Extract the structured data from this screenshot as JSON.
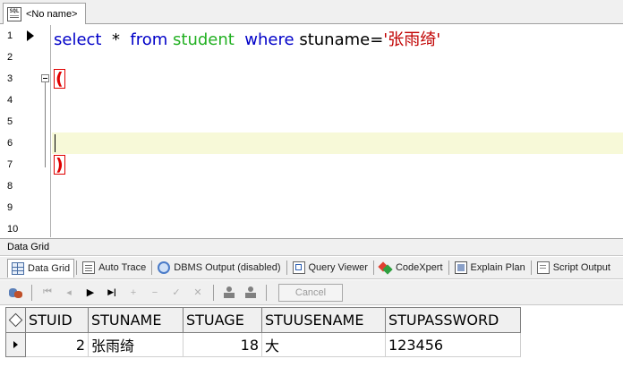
{
  "document_tab": {
    "label": "<No name>",
    "icon": "sql-file-icon"
  },
  "editor": {
    "line_numbers": [
      "1",
      "2",
      "3",
      "4",
      "5",
      "6",
      "7",
      "8",
      "9",
      "10"
    ],
    "query": {
      "select_kw": "select",
      "star": "*",
      "from_kw": "from",
      "table": "student",
      "where_kw": "where",
      "condition": "stuname=",
      "literal": "'张雨绮'"
    },
    "open_paren": "(",
    "close_paren": ")"
  },
  "panel": {
    "title": "Data Grid"
  },
  "bottom_tabs": [
    {
      "label": "Data Grid",
      "icon": "data-grid-icon"
    },
    {
      "label": "Auto Trace",
      "icon": "auto-trace-icon"
    },
    {
      "label": "DBMS Output (disabled)",
      "icon": "dbms-output-icon"
    },
    {
      "label": "Query Viewer",
      "icon": "query-viewer-icon"
    },
    {
      "label": "CodeXpert",
      "icon": "codexpert-icon"
    },
    {
      "label": "Explain Plan",
      "icon": "explain-plan-icon"
    },
    {
      "label": "Script Output",
      "icon": "script-output-icon"
    }
  ],
  "toolbar": {
    "cancel_label": "Cancel",
    "glyphs": {
      "first": "⏮",
      "prior": "◂",
      "play": "▶",
      "last": "▶|",
      "insert": "+",
      "delete": "−",
      "edit": "✓",
      "clear": "✕"
    }
  },
  "grid": {
    "columns": [
      "STUID",
      "STUNAME",
      "STUAGE",
      "STUUSENAME",
      "STUPASSWORD"
    ],
    "rows": [
      [
        "2",
        "张雨绮",
        "18",
        "大",
        "123456"
      ]
    ]
  },
  "colors": {
    "keyword": "#0000c8",
    "table_name": "#22b022",
    "string_literal": "#c00000",
    "paren_highlight": "#e00000",
    "current_line": "#f7f9d8"
  }
}
